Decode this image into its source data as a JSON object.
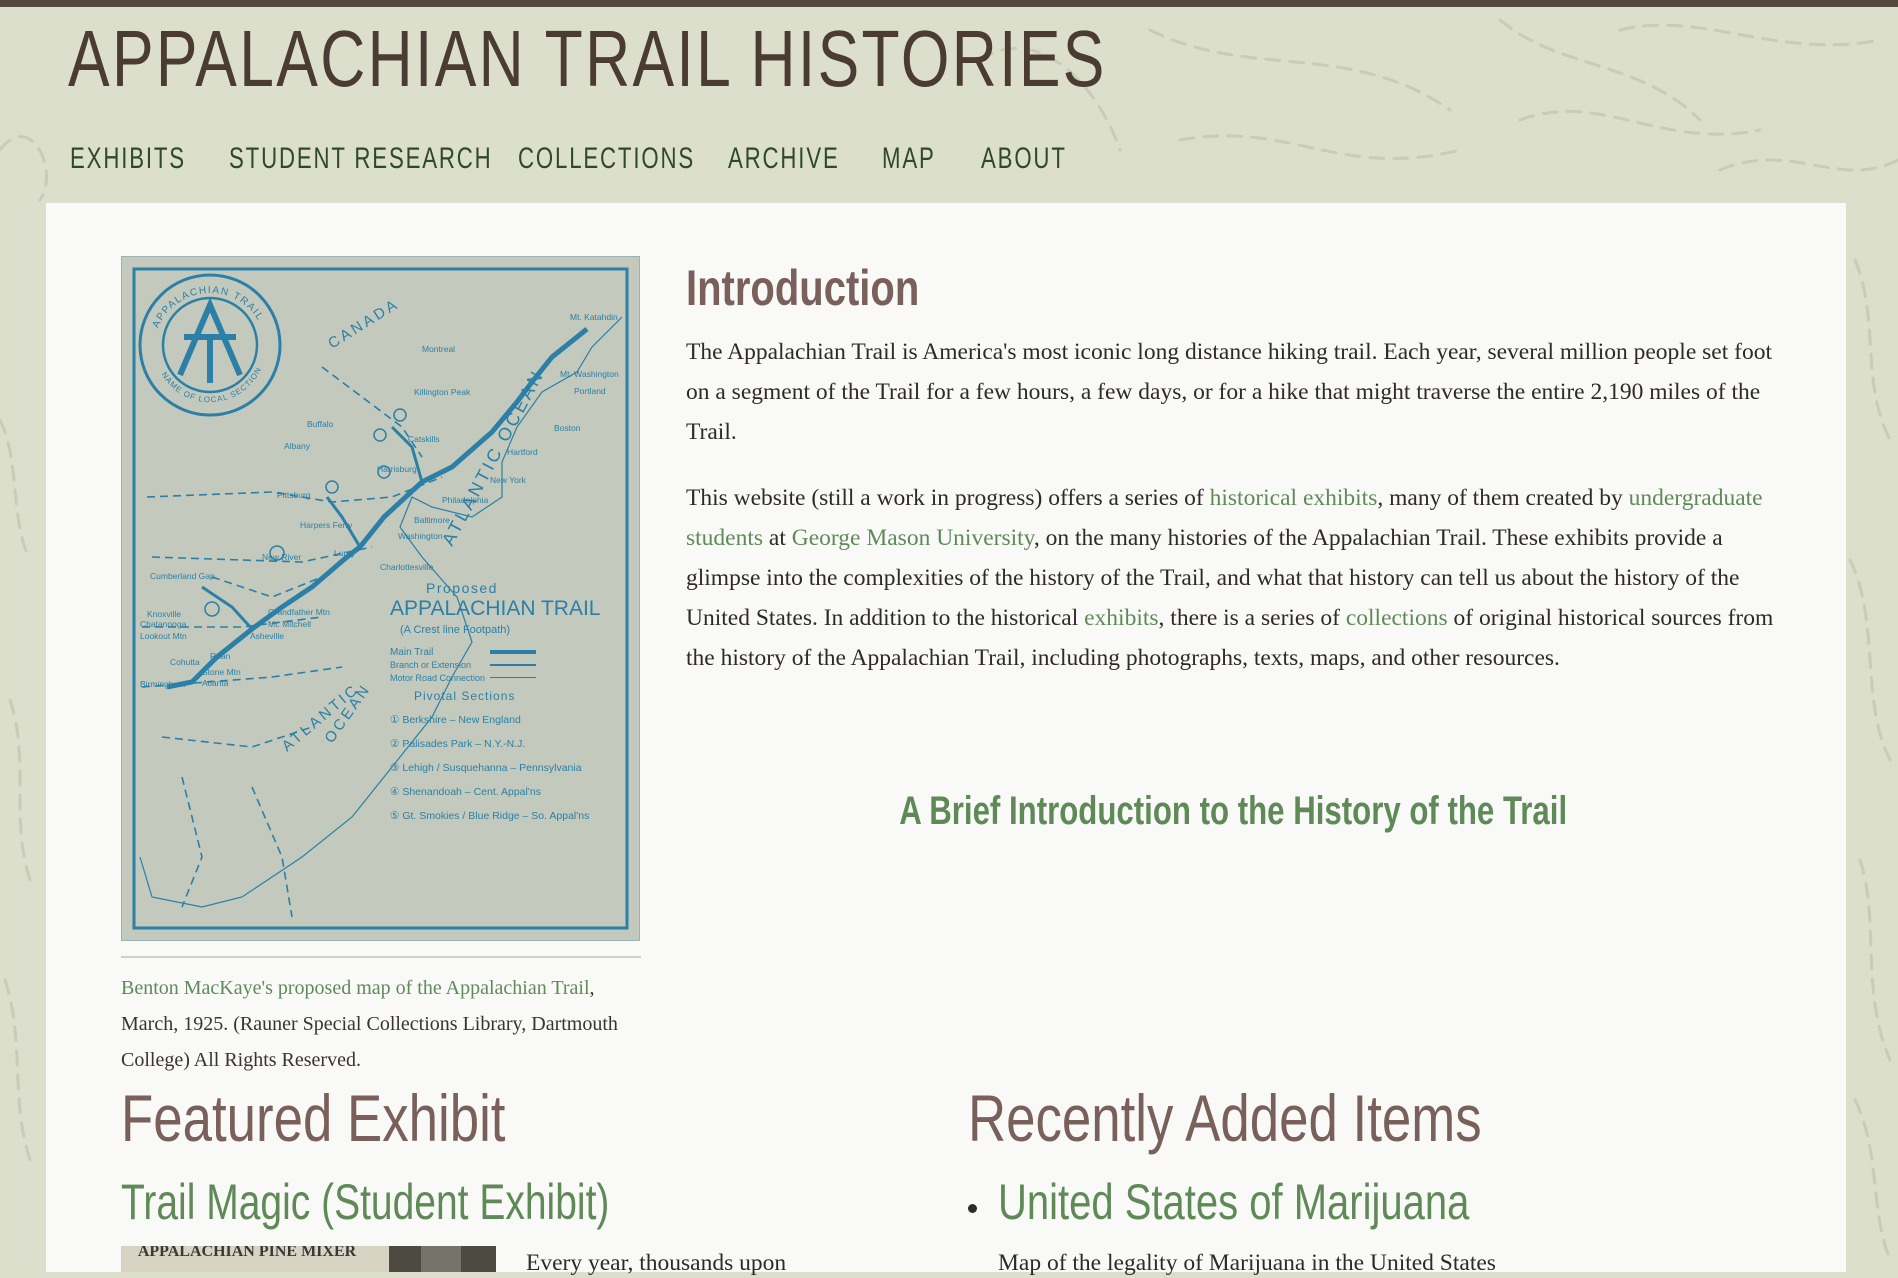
{
  "site": {
    "title": "APPALACHIAN TRAIL HISTORIES"
  },
  "nav": {
    "items": [
      {
        "label": "EXHIBITS"
      },
      {
        "label": "STUDENT RESEARCH"
      },
      {
        "label": "COLLECTIONS"
      },
      {
        "label": "ARCHIVE"
      },
      {
        "label": "MAP"
      },
      {
        "label": "ABOUT"
      }
    ]
  },
  "figure": {
    "map_text": {
      "emblem_top": "APPALACHIAN TRAIL",
      "emblem_bottom": "NAME OF LOCAL SECTION",
      "canada": "CANADA",
      "atlantic_ocean_upper": "ATLANTIC OCEAN",
      "atlantic": "ATLANTIC",
      "ocean": "OCEAN",
      "proposed": "Proposed",
      "map_title": "APPALACHIAN TRAIL",
      "map_subtitle": "(A Crest line Footpath)",
      "legend_main": "Main Trail",
      "legend_branch": "Branch or Extension",
      "legend_motor": "Motor Road Connection",
      "pivotal": "Pivotal Sections",
      "sections": [
        "① Berkshire – New England",
        "② Palisades Park – N.Y.-N.J.",
        "③ Lehigh / Susquehanna – Pennsylvania",
        "④ Shenandoah – Cent. Appal'ns",
        "⑤ Gt. Smokies / Blue Ridge – So. Appal'ns"
      ],
      "cities": [
        "Mt. Katahdin",
        "Montreal",
        "Mt. Washington",
        "Portland",
        "Killington Peak",
        "Boston",
        "Buffalo",
        "Albany",
        "Catskills",
        "Hartford",
        "New York",
        "Harrisburg",
        "Pittsburg",
        "Philadelphia",
        "Baltimore",
        "Washington",
        "Harpers Ferry",
        "Luray",
        "Charlottesville",
        "New River",
        "Cumberland Gap",
        "Knoxville",
        "Grandfather Mtn",
        "Mt. Mitchell",
        "Chatanooga",
        "Asheville",
        "Lookout Mtn",
        "Cohutta",
        "Stone Mtn",
        "Atlanta",
        "Birmingham",
        "Roan"
      ]
    },
    "caption": {
      "link_text": "Benton MacKaye's proposed map of the Appalachian Trail",
      "rest_text": ", March, 1925. (Rauner Special Collections Library, Dartmouth College) All Rights Reserved."
    }
  },
  "intro": {
    "heading": "Introduction",
    "p1": "The Appalachian Trail is America's most iconic long distance hiking trail. Each year, several million people set foot on a segment of the Trail for a few hours, a few days, or for a hike that might traverse the entire 2,190 miles of the Trail.",
    "p2": {
      "t1": "This website (still a work in progress) offers a series of ",
      "link_exhibits": "historical exhibits",
      "t2": ", many of them created by ",
      "link_students": "undergraduate students",
      "t3": " at ",
      "link_gmu": "George Mason University",
      "t4": ", on the many histories of the Appalachian Trail. These exhibits provide a glimpse into the complexities of the history of the Trail, and what that history can tell us about the history of the United States. In addition to the historical ",
      "link_exhibits2": "exhibits",
      "t5": ", there is a series of ",
      "link_collections": "collections",
      "t6": " of original historical sources from the history of the Appalachian Trail, including photographs, texts, maps, and other resources."
    },
    "brief_link": "A Brief Introduction to the History of the Trail"
  },
  "featured": {
    "heading": "Featured Exhibit",
    "title": "Trail Magic (Student Exhibit)",
    "thumb_text": "APPALACHIAN PINE MIXER",
    "text": "Every year, thousands upon"
  },
  "recent": {
    "heading": "Recently Added Items",
    "items": [
      {
        "title": "United States of Marijuana",
        "desc": "Map of the legality of Marijuana in the United States"
      }
    ]
  },
  "colors": {
    "accent_link": "#5f8a58",
    "heading_brown": "#7a605a",
    "title_dark": "#4a3b33",
    "nav_green": "#2f4a2a",
    "map_blue": "#2c7fa6",
    "map_paper": "#c3cabd",
    "page_bg": "#dcdfcb"
  }
}
